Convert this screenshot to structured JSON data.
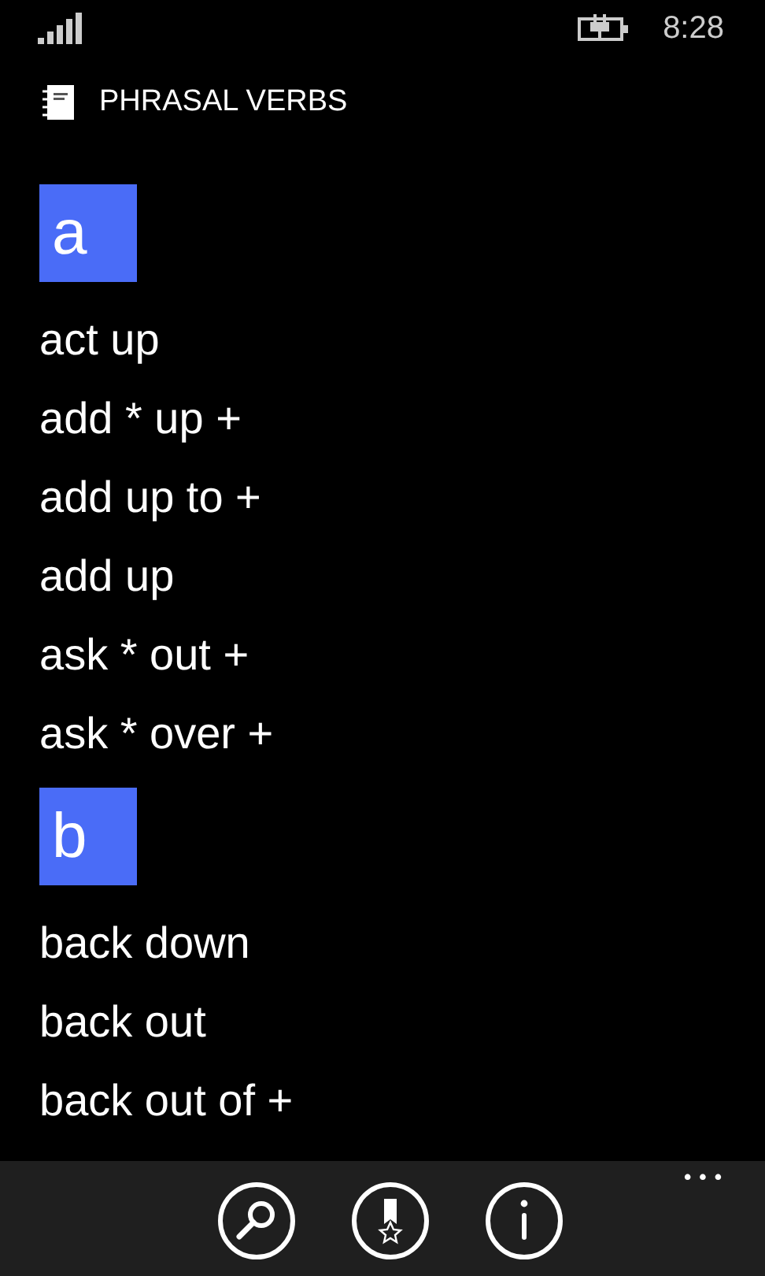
{
  "status_bar": {
    "time": "8:28"
  },
  "app": {
    "title": "PHRASAL VERBS"
  },
  "groups": [
    {
      "letter": "a",
      "items": [
        "act up",
        "add * up +",
        "add up to +",
        "add up",
        "ask * out +",
        "ask * over +"
      ]
    },
    {
      "letter": "b",
      "items": [
        "back down",
        "back out",
        "back out of +"
      ]
    }
  ],
  "app_bar": {
    "buttons": [
      {
        "kind": "search"
      },
      {
        "kind": "favorites"
      },
      {
        "kind": "info"
      }
    ],
    "more": "•••"
  }
}
